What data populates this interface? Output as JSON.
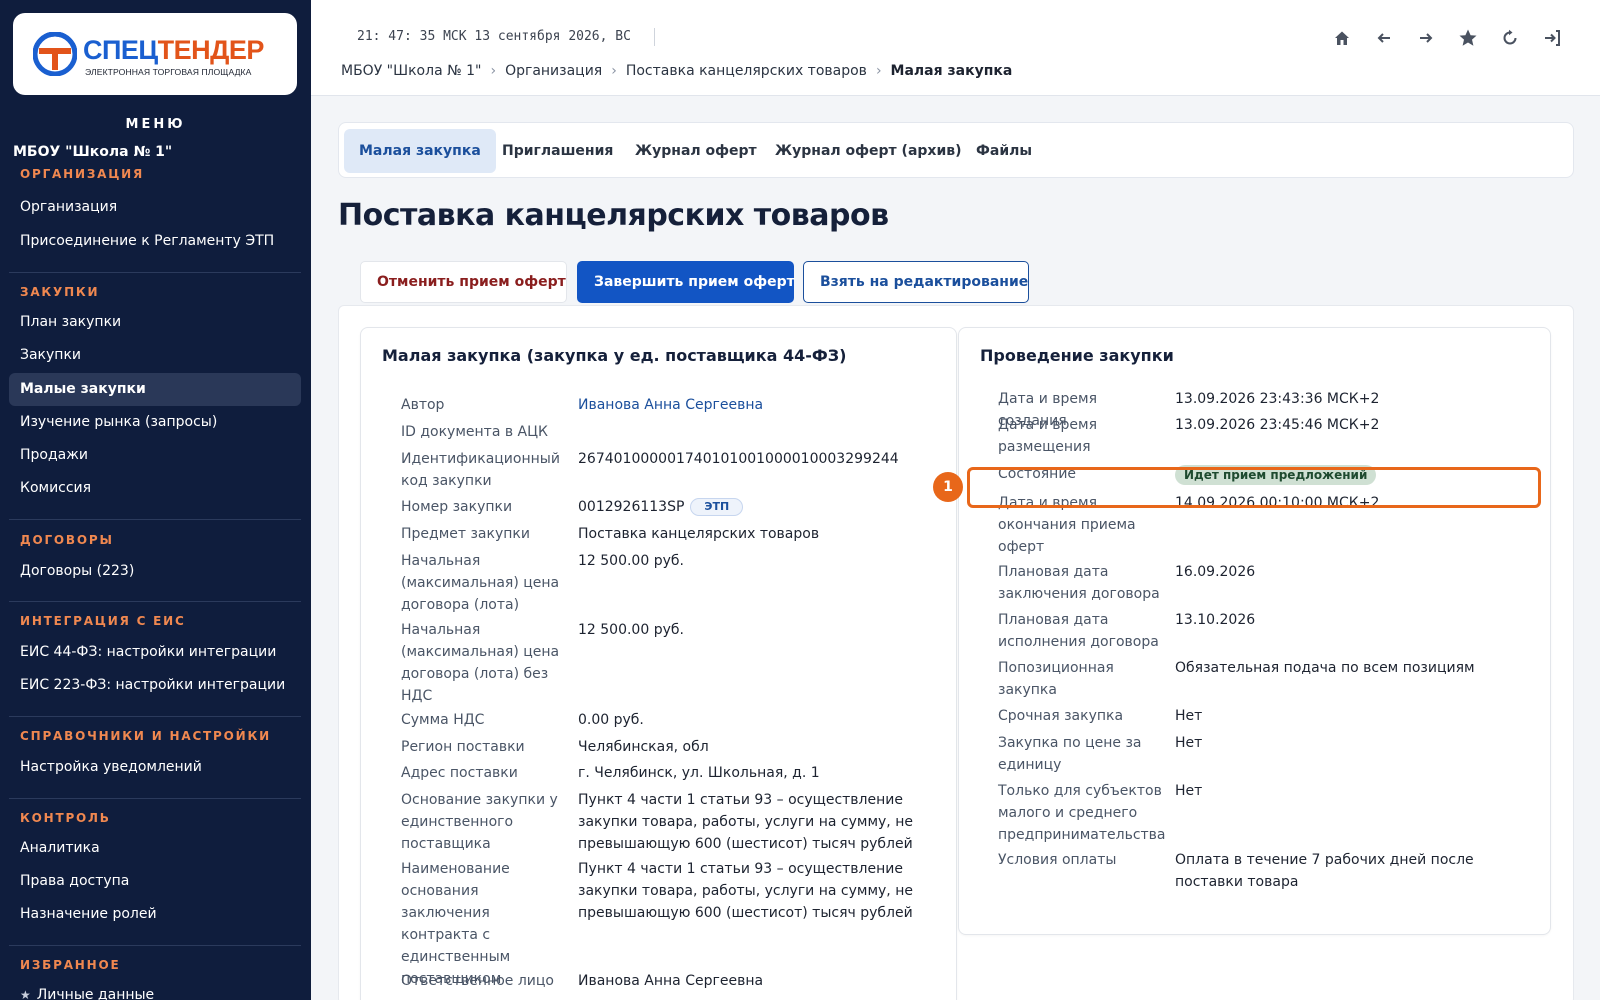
{
  "brand": {
    "name_part1": "СПЕЦ",
    "name_part2": "ТЕНДЕР",
    "subtitle": "ЭЛЕКТРОННАЯ ТОРГОВАЯ ПЛОЩАДКА",
    "primary_color": "#1a5fd0",
    "accent_color": "#e2541a"
  },
  "sidebar": {
    "menu_label": "МЕНЮ",
    "org_name": "МБОУ \"Школа № 1\"",
    "sections": [
      {
        "title": "ОРГАНИЗАЦИЯ",
        "items": [
          "Организация",
          "Присоединение к Регламенту ЭТП"
        ]
      },
      {
        "title": "ЗАКУПКИ",
        "items": [
          "План закупки",
          "Закупки",
          "Малые закупки",
          "Изучение рынка (запросы)",
          "Продажи",
          "Комиссия"
        ]
      },
      {
        "title": "ДОГОВОРЫ",
        "items": [
          "Договоры (223)"
        ]
      },
      {
        "title": "ИНТЕГРАЦИЯ С ЕИС",
        "items": [
          "ЕИС 44-ФЗ: настройки интеграции",
          "ЕИС 223-ФЗ: настройки интеграции"
        ]
      },
      {
        "title": "СПРАВОЧНИКИ И НАСТРОЙКИ",
        "items": [
          "Настройка уведомлений"
        ]
      },
      {
        "title": "КОНТРОЛЬ",
        "items": [
          "Аналитика",
          "Права доступа",
          "Назначение ролей"
        ]
      },
      {
        "title": "ИЗБРАННОЕ",
        "items": [
          "Личные данные"
        ]
      }
    ],
    "active_item": "Малые закупки"
  },
  "topbar": {
    "clock": "21: 47: 35 МСК  13 сентября 2026, ВС",
    "breadcrumb": [
      "МБОУ \"Школа № 1\"",
      "Организация",
      "Поставка канцелярских товаров",
      "Малая закупка"
    ],
    "icons": [
      "home-icon",
      "arrow-left-icon",
      "arrow-right-icon",
      "star-icon",
      "refresh-icon",
      "logout-icon"
    ]
  },
  "tabs": [
    "Малая закупка",
    "Приглашения",
    "Журнал оферт",
    "Журнал оферт (архив)",
    "Файлы"
  ],
  "active_tab": "Малая закупка",
  "page_title": "Поставка канцелярских товаров",
  "actions": {
    "cancel": "Отменить прием оферт",
    "finish": "Завершить прием оферт",
    "edit": "Взять на редактирование"
  },
  "left_card": {
    "title": "Малая закупка (закупка у ед. поставщика 44-ФЗ)",
    "rows": [
      {
        "label": "Автор",
        "value": "Иванова Анна Сергеевна"
      },
      {
        "label": "ID документа в АЦК",
        "value": ""
      },
      {
        "label": "Идентификационный код закупки",
        "value": "267401000001740101001000010003299244"
      },
      {
        "label": "Номер закупки",
        "value": "0012926113SP",
        "tag": "ЭТП"
      },
      {
        "label": "Предмет закупки",
        "value": "Поставка канцелярских товаров"
      },
      {
        "label": "Начальная (максимальная) цена договора (лота)",
        "value": "12 500.00 руб."
      },
      {
        "label": "Начальная (максимальная) цена договора (лота) без НДС",
        "value": "12 500.00 руб."
      },
      {
        "label": "Сумма НДС",
        "value": "0.00 руб."
      },
      {
        "label": "Регион поставки",
        "value": "Челябинская, обл"
      },
      {
        "label": "Адрес поставки",
        "value": "г. Челябинск, ул. Школьная, д. 1"
      },
      {
        "label": "Основание закупки у единственного поставщика",
        "value": "Пункт 4 части 1 статьи 93 – осуществление закупки товара, работы, услуги на сумму, не превышающую 600 (шестисот) тысяч рублей"
      },
      {
        "label": "Наименование основания заключения контракта с единственным поставщиком",
        "value": "Пункт 4 части 1 статьи 93 – осуществление закупки товара, работы, услуги на сумму, не превышающую 600 (шестисот) тысяч рублей"
      },
      {
        "label": "Ответственное лицо",
        "value": "Иванова Анна Сергеевна"
      }
    ]
  },
  "right_card": {
    "title": "Проведение закупки",
    "rows": [
      {
        "label": "Дата и время создания",
        "value": "13.09.2026 23:43:36 МСК+2"
      },
      {
        "label": "Дата и время размещения",
        "value": "13.09.2026 23:45:46 МСК+2"
      },
      {
        "label": "Состояние",
        "value": "Идет прием предложений"
      },
      {
        "label": "Дата и время окончания приема оферт",
        "value": "14.09.2026 00:10:00 МСК+2"
      },
      {
        "label": "Плановая дата заключения договора",
        "value": "16.09.2026"
      },
      {
        "label": "Плановая дата исполнения договора",
        "value": "13.10.2026"
      },
      {
        "label": "Попозиционная закупка",
        "value": "Обязательная подача по всем позициям"
      },
      {
        "label": "Срочная закупка",
        "value": "Нет"
      },
      {
        "label": "Закупка по цене за единицу",
        "value": "Нет"
      },
      {
        "label": "Только для субъектов малого и среднего предпринимательства",
        "value": "Нет"
      },
      {
        "label": "Условия оплаты",
        "value": "Оплата в течение 7 рабочих дней после поставки товара"
      }
    ]
  },
  "annotation": {
    "marker": "1",
    "color": "#e8671a"
  }
}
